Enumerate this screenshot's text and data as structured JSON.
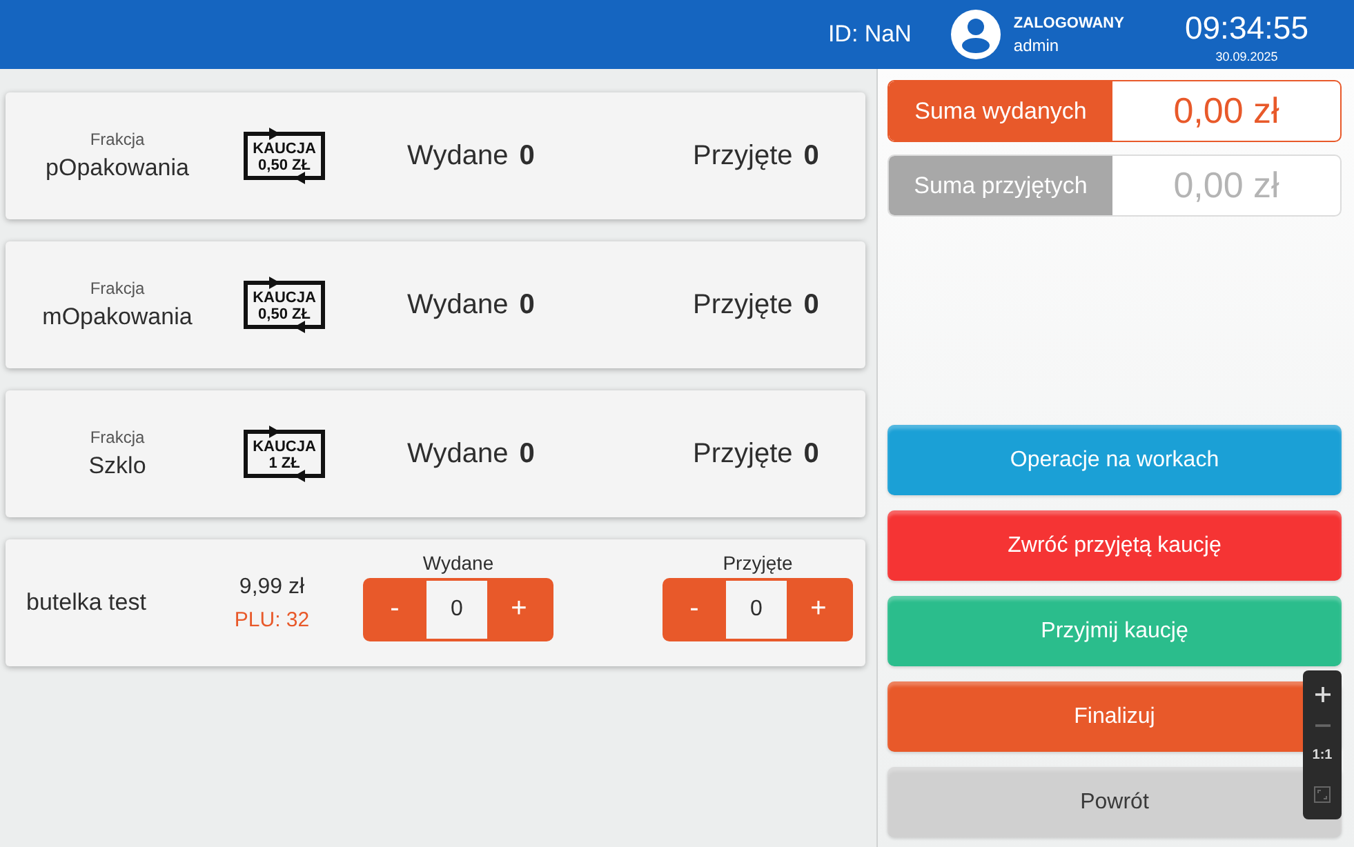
{
  "header": {
    "session_id": "ID: NaN",
    "user_status": "ZALOGOWANY",
    "user_name": "admin",
    "time": "09:34:55",
    "date": "30.09.2025"
  },
  "fractions": [
    {
      "caption": "Frakcja",
      "name": "pOpakowania",
      "deposit_label": "KAUCJA",
      "deposit_value": "0,50 ZŁ",
      "issued_label": "Wydane",
      "issued": "0",
      "received_label": "Przyjęte",
      "received": "0"
    },
    {
      "caption": "Frakcja",
      "name": "mOpakowania",
      "deposit_label": "KAUCJA",
      "deposit_value": "0,50 ZŁ",
      "issued_label": "Wydane",
      "issued": "0",
      "received_label": "Przyjęte",
      "received": "0"
    },
    {
      "caption": "Frakcja",
      "name": "Szklo",
      "deposit_label": "KAUCJA",
      "deposit_value": "1 ZŁ",
      "issued_label": "Wydane",
      "issued": "0",
      "received_label": "Przyjęte",
      "received": "0"
    }
  ],
  "product": {
    "name": "butelka test",
    "price": "9,99 zł",
    "plu": "PLU: 32",
    "counters": [
      {
        "label": "Wydane",
        "minus": "-",
        "value": "0",
        "plus": "+"
      },
      {
        "label": "Przyjęte",
        "minus": "-",
        "value": "0",
        "plus": "+"
      }
    ]
  },
  "totals": [
    {
      "label": "Suma wydanych",
      "value": "0,00 zł",
      "active": true
    },
    {
      "label": "Suma przyjętych",
      "value": "0,00 zł",
      "active": false
    }
  ],
  "actions": [
    {
      "label": "Operacje na workach",
      "color": "#1ba0d6"
    },
    {
      "label": "Zwróć przyjętą kaucję",
      "color": "#f53434"
    },
    {
      "label": "Przyjmij kaucję",
      "color": "#2bbd8c"
    },
    {
      "label": "Finalizuj",
      "color": "#e8592a"
    },
    {
      "label": "Powrót",
      "color": "#d0d0d0"
    }
  ],
  "zoom_controls": [
    {
      "kind": "zoom_in",
      "disabled": false
    },
    {
      "kind": "zoom_out",
      "disabled": true
    },
    {
      "kind": "reset",
      "label": "1:1",
      "disabled": false
    },
    {
      "kind": "fit",
      "disabled": true
    }
  ]
}
